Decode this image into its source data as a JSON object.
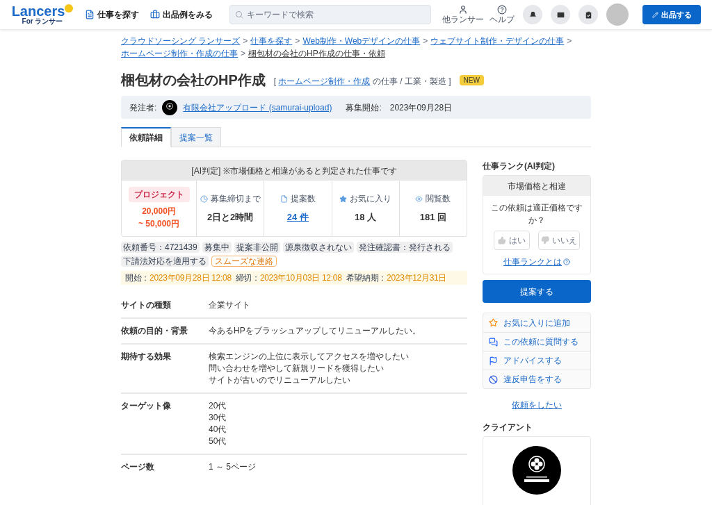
{
  "header": {
    "logo": {
      "word": "Lancers",
      "sub": "For ランサー"
    },
    "nav": [
      "仕事を探す",
      "出品例をみる"
    ],
    "search": {
      "placeholder": "キーワードで検索"
    },
    "links": [
      "他ランサー",
      "ヘルプ"
    ],
    "post_button": "出品する"
  },
  "breadcrumb": {
    "links": [
      "クラウドソーシング ランサーズ",
      "仕事を探す",
      "Web制作・Webデザインの仕事",
      "ウェブサイト制作・デザインの仕事",
      "ホームページ制作・作成の仕事"
    ],
    "separator": ">",
    "current": "梱包材の会社のHP作成の仕事・依頼"
  },
  "title": "梱包材の会社のHP作成",
  "category": {
    "open": "[",
    "link": "ホームページ制作・作成",
    "rest": "の仕事 / 工業・製造",
    "close": "]"
  },
  "new_badge": "NEW",
  "client_bar": {
    "label": "発注者:",
    "name": "有限会社アップロード (samurai-upload)",
    "start_label": "募集開始:",
    "start": "2023年09月28日"
  },
  "tabs": [
    {
      "label": "依頼詳細",
      "selected": true
    },
    {
      "label": "提案一覧",
      "selected": false
    }
  ],
  "ai_notice": "[AI判定] ※市場価格と相違があると判定された仕事です",
  "project": {
    "type": "プロジェクト",
    "price_min": "20,000円",
    "price_max": "~ 50,000円"
  },
  "stats": [
    {
      "label": "募集締切まで",
      "value": "2日と2時間"
    },
    {
      "label": "提案数",
      "value": "24 件"
    },
    {
      "label": "お気に入り",
      "value": "18 人"
    },
    {
      "label": "閲覧数",
      "value": "181 回"
    }
  ],
  "tags": [
    "依頼番号：4721439",
    "募集中",
    "提案非公開",
    "源泉徴収されない",
    "発注確認書：発行される",
    "下請法対応を適用する"
  ],
  "badge": "スムーズな連絡",
  "dates": [
    {
      "label": "開始：",
      "value": "2023年09月28日 12:08"
    },
    {
      "label": "締切：",
      "value": "2023年10月03日 12:08"
    },
    {
      "label": "希望納期：",
      "value": "2023年12月31日"
    }
  ],
  "details": [
    {
      "label": "サイトの種類",
      "lines": [
        "企業サイト"
      ]
    },
    {
      "label": "依頼の目的・背景",
      "lines": [
        "今あるHPをブラッシュアップしてリニューアルしたい。"
      ]
    },
    {
      "label": "期待する効果",
      "lines": [
        "検索エンジンの上位に表示してアクセスを増やしたい",
        "問い合わせを増やして新規リードを獲得したい",
        "サイトが古いのでリニューアルしたい"
      ]
    },
    {
      "label": "ターゲット像",
      "lines": [
        "20代",
        "30代",
        "40代",
        "50代"
      ]
    },
    {
      "label": "ページ数",
      "lines": [
        "1 ～ 5ページ"
      ]
    }
  ],
  "rank": {
    "heading": "仕事ランク(AI判定)",
    "result": "市場価格と相違",
    "question": "この依頼は適正価格ですか？",
    "yes": "はい",
    "no": "いいえ",
    "link": "仕事ランクとは"
  },
  "propose_button": "提案する",
  "actions": [
    "お気に入りに追加",
    "この依頼に質問する",
    "アドバイスする",
    "違反申告をする"
  ],
  "request_link": "依頼をしたい",
  "client": {
    "heading": "クライアント"
  }
}
